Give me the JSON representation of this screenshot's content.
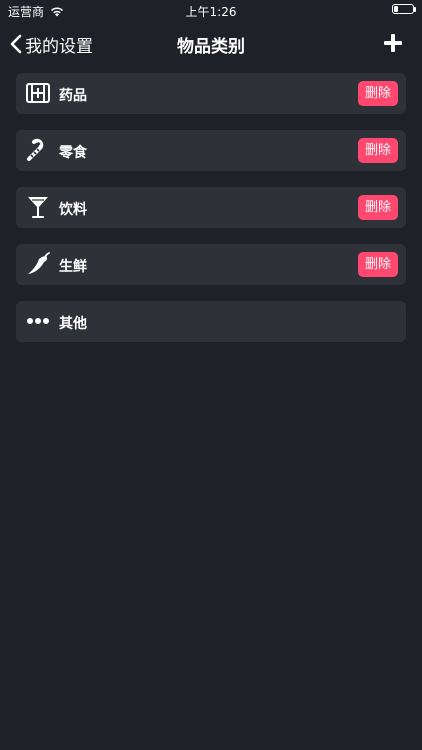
{
  "status_bar": {
    "carrier": "运营商",
    "time": "上午1:26"
  },
  "nav": {
    "back_label": "我的设置",
    "title": "物品类别"
  },
  "categories": [
    {
      "label": "药品",
      "icon": "medicine-icon",
      "delete_label": "删除"
    },
    {
      "label": "零食",
      "icon": "candy-cane-icon",
      "delete_label": "删除"
    },
    {
      "label": "饮料",
      "icon": "cocktail-icon",
      "delete_label": "删除"
    },
    {
      "label": "生鲜",
      "icon": "chili-pepper-icon",
      "delete_label": "删除"
    },
    {
      "label": "其他",
      "icon": "more-dots-icon"
    }
  ],
  "colors": {
    "background": "#1f2128",
    "row_background": "#2f3139",
    "delete_button": "#ff4870",
    "text": "#ffffff"
  }
}
